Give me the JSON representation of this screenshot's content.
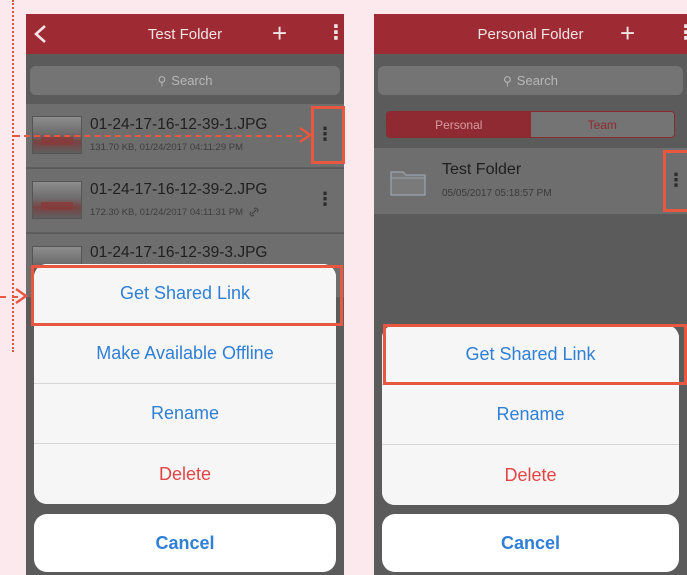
{
  "left_screen": {
    "title": "Test Folder",
    "search_placeholder": "Search",
    "files": [
      {
        "name": "01-24-17-16-12-39-1.JPG",
        "meta": "131.70 KB, 01/24/2017 04:11:29 PM",
        "shared": false
      },
      {
        "name": "01-24-17-16-12-39-2.JPG",
        "meta": "172.30 KB, 01/24/2017 04:11:31 PM",
        "shared": true
      },
      {
        "name": "01-24-17-16-12-39-3.JPG",
        "meta": "",
        "shared": false
      }
    ],
    "action_sheet": [
      "Get Shared Link",
      "Make Available Offline",
      "Rename",
      "Delete"
    ],
    "cancel_label": "Cancel"
  },
  "right_screen": {
    "title": "Personal Folder",
    "search_placeholder": "Search",
    "tabs": [
      "Personal",
      "Team"
    ],
    "selected_tab": "Personal",
    "folder": {
      "name": "Test Folder",
      "meta": "05/05/2017 05:18:57 PM"
    },
    "action_sheet": [
      "Get Shared Link",
      "Rename",
      "Delete"
    ],
    "cancel_label": "Cancel"
  },
  "colors": {
    "navbar": "#9e2b34",
    "action_blue": "#2f7fd6",
    "destructive_red": "#e34545",
    "highlight": "#e8573f",
    "page_background": "#fbe9ee"
  },
  "icons": [
    "back-chevron-icon",
    "plus-icon",
    "more-vertical-icon",
    "search-icon",
    "folder-icon",
    "link-icon"
  ]
}
